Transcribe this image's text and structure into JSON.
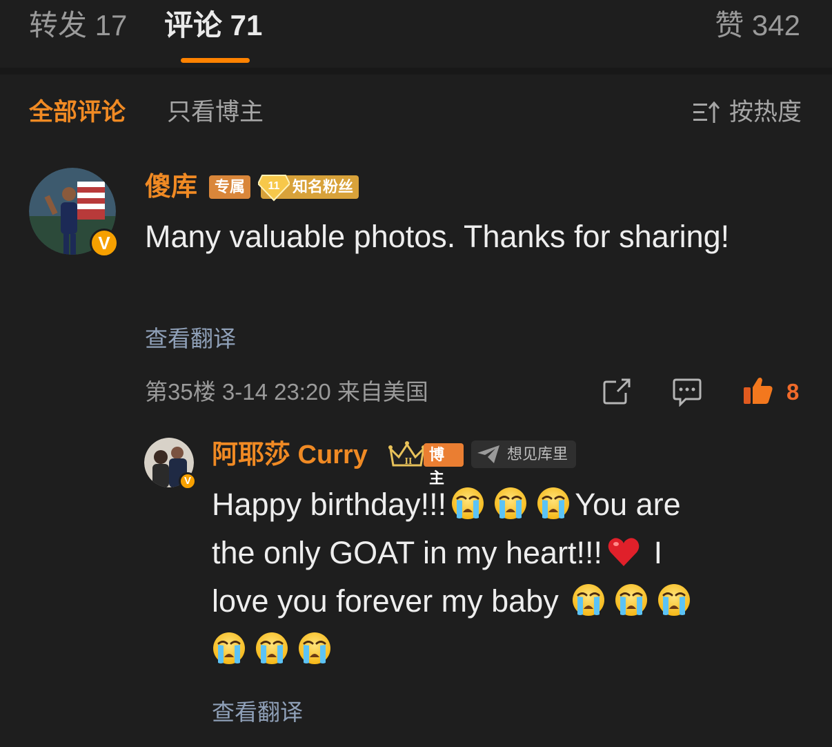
{
  "tabs": {
    "repost": "转发 17",
    "comment": "评论 71",
    "like": "赞 342"
  },
  "filters": {
    "all": "全部评论",
    "blogger_only": "只看博主",
    "sort": "按热度"
  },
  "comment": {
    "username": "傻库",
    "badge_exclusive": "专属",
    "badge_fan_level": "11",
    "badge_fan": "知名粉丝",
    "verified_badge": "V",
    "text": "Many valuable photos. Thanks for sharing!",
    "translate": "查看翻译",
    "meta": "第35楼 3-14 23:20 来自美国",
    "like_count": "8",
    "icons": {
      "share": "share-icon",
      "reply": "comment-icon",
      "like": "thumbs-up-icon"
    }
  },
  "reply": {
    "username": "阿耶莎 Curry",
    "badge_blogger": "博主",
    "badge_blogger_level": "II",
    "badge_tag": "想见库里",
    "line1_text": "Happy birthday!!!",
    "line1_after": "You are",
    "line2_text": "the only GOAT in my heart!!!",
    "line2_after": "I",
    "line3_text": "love you forever my baby",
    "translate": "查看翻译",
    "emoji_name": "crying-emoji",
    "heart_name": "red-heart-emoji"
  },
  "colors": {
    "background": "#1e1e1e",
    "accent": "#ff8200",
    "username": "#f08a24",
    "translate_link": "#8fa0b8",
    "like_active": "#f06a2a"
  }
}
